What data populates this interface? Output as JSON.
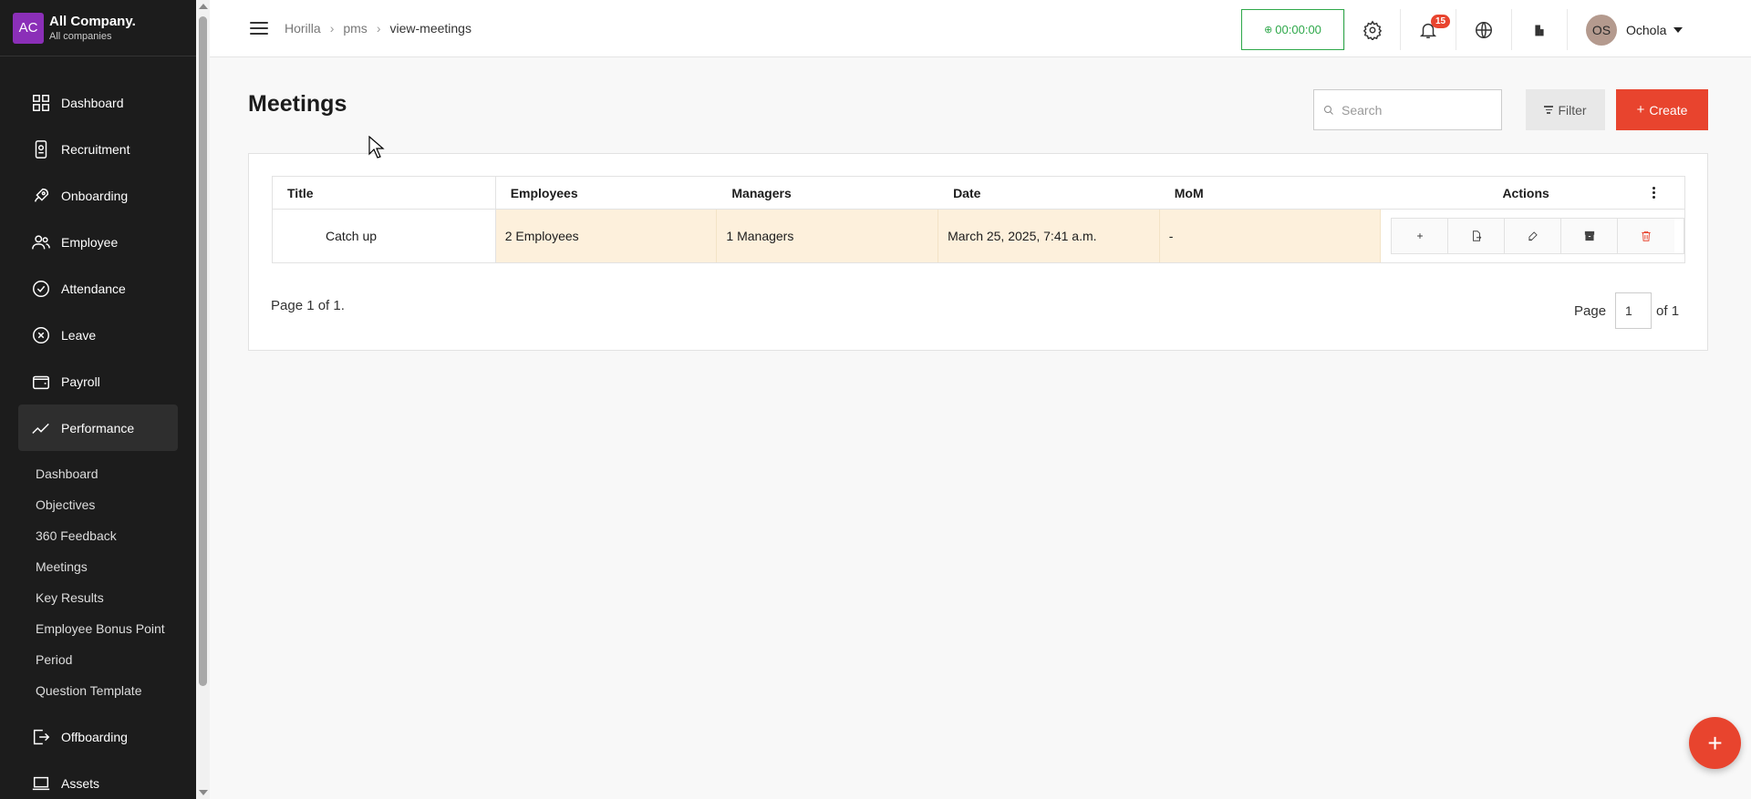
{
  "company": {
    "logo": "AC",
    "name": "All Company.",
    "sub": "All companies"
  },
  "sidebar": {
    "items": [
      {
        "label": "Dashboard",
        "icon": "dashboard-icon"
      },
      {
        "label": "Recruitment",
        "icon": "recruitment-icon"
      },
      {
        "label": "Onboarding",
        "icon": "rocket-icon"
      },
      {
        "label": "Employee",
        "icon": "people-icon"
      },
      {
        "label": "Attendance",
        "icon": "check-circle-icon"
      },
      {
        "label": "Leave",
        "icon": "x-circle-icon"
      },
      {
        "label": "Payroll",
        "icon": "wallet-icon"
      },
      {
        "label": "Performance",
        "icon": "trend-icon"
      }
    ],
    "performance_sub": [
      "Dashboard",
      "Objectives",
      "360 Feedback",
      "Meetings",
      "Key Results",
      "Employee Bonus Point",
      "Period",
      "Question Template"
    ],
    "after_items": [
      {
        "label": "Offboarding",
        "icon": "exit-icon"
      },
      {
        "label": "Assets",
        "icon": "laptop-icon"
      }
    ]
  },
  "breadcrumb": [
    "Horilla",
    "pms",
    "view-meetings"
  ],
  "timer": "00:00:00",
  "notifications_count": "15",
  "user": {
    "initials": "OS",
    "name": "Ochola"
  },
  "page": {
    "title": "Meetings"
  },
  "search": {
    "placeholder": "Search"
  },
  "buttons": {
    "filter": "Filter",
    "create": "Create"
  },
  "table": {
    "headers": [
      "Title",
      "Employees",
      "Managers",
      "Date",
      "MoM",
      "Actions"
    ],
    "rows": [
      {
        "title": "Catch up",
        "employees": "2 Employees",
        "managers": "1 Managers",
        "date": "March 25, 2025, 7:41 a.m.",
        "mom": "-"
      }
    ]
  },
  "pagination": {
    "info": "Page 1 of 1.",
    "page_label": "Page",
    "current": "1",
    "of_label": "of 1"
  },
  "colors": {
    "accent": "#e8442e",
    "timer": "#2ea84a",
    "sidebar": "#1c1c1c",
    "highlight": "#fdf0dc"
  }
}
